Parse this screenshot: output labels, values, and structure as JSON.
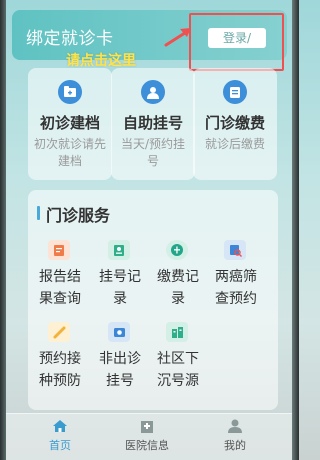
{
  "bind_card": {
    "title": "绑定就诊卡",
    "login_label": "登录/",
    "annotation": "请点击这里"
  },
  "quick": [
    {
      "title": "初诊建档",
      "sub": "初次就诊请先建档",
      "icon": "folder-icon"
    },
    {
      "title": "自助挂号",
      "sub": "当天/预约挂号",
      "icon": "doctor-icon"
    },
    {
      "title": "门诊缴费",
      "sub": "就诊后缴费",
      "icon": "payment-icon"
    }
  ],
  "services": {
    "title": "门诊服务",
    "items": [
      {
        "label": "报告结果查询",
        "icon": "report-icon",
        "color": "#f07b4a"
      },
      {
        "label": "挂号记录",
        "icon": "registration-record-icon",
        "color": "#2fae8a"
      },
      {
        "label": "缴费记录",
        "icon": "payment-record-icon",
        "color": "#23a58a"
      },
      {
        "label": "两癌筛查预约",
        "icon": "screening-icon",
        "color": "#3b86d6"
      },
      {
        "label": "预约接种预防",
        "icon": "vaccine-icon",
        "color": "#f3b23a"
      },
      {
        "label": "非出诊挂号",
        "icon": "camera-icon",
        "color": "#3b86d6"
      },
      {
        "label": "社区下沉号源",
        "icon": "community-icon",
        "color": "#2fae8a"
      }
    ]
  },
  "tabs": [
    {
      "label": "首页",
      "icon": "home-icon",
      "active": true
    },
    {
      "label": "医院信息",
      "icon": "hospital-icon",
      "active": false
    },
    {
      "label": "我的",
      "icon": "user-icon",
      "active": false
    }
  ],
  "colors": {
    "accent": "#3a9bcf",
    "card_green": "#5fc2c2",
    "annotation_red": "#f05050",
    "annotation_yellow": "#ffe34a"
  }
}
